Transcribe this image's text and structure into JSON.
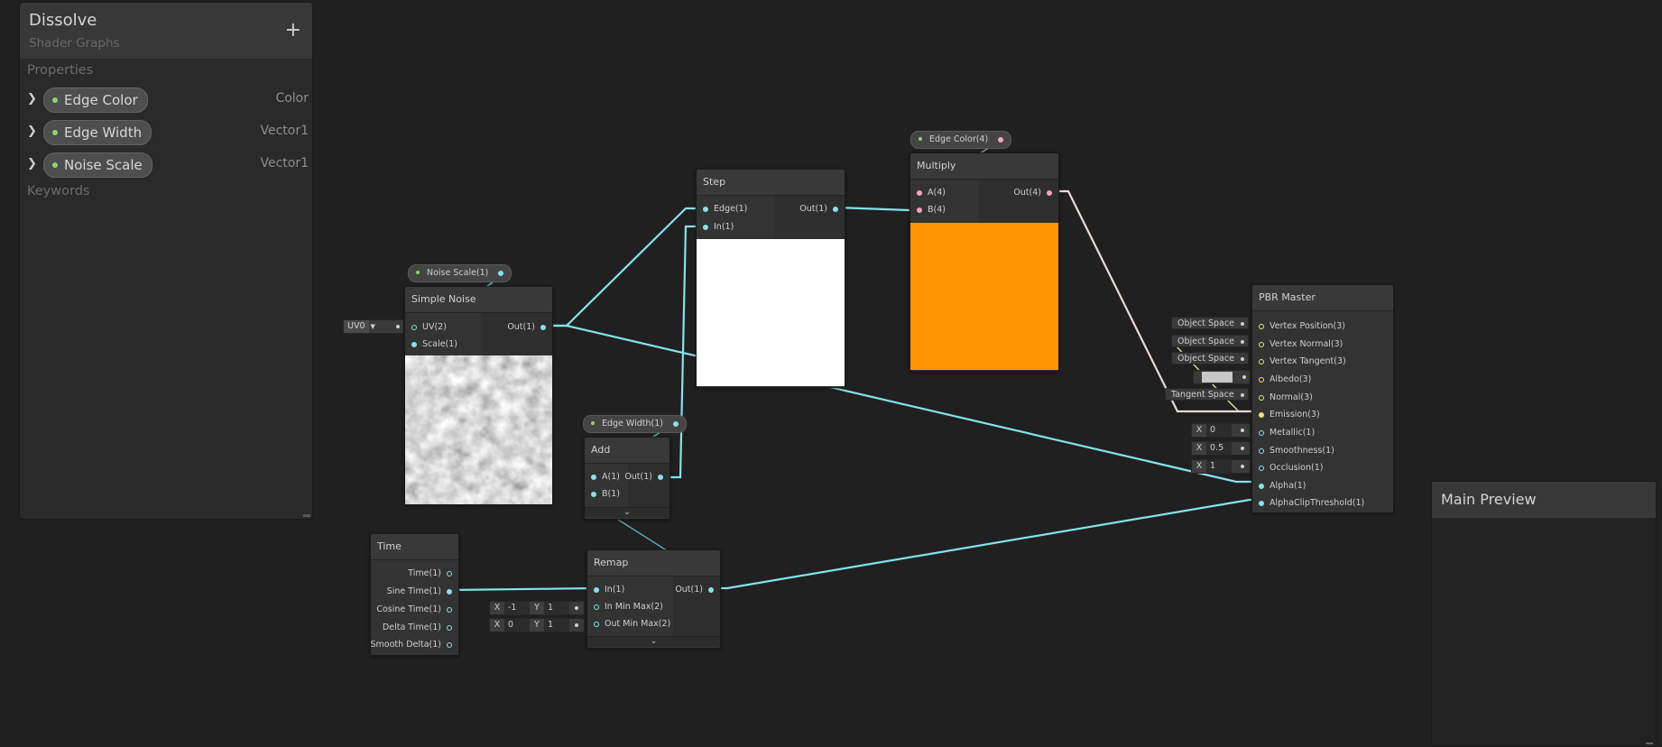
{
  "blackboard": {
    "title": "Dissolve",
    "subtitle": "Shader Graphs",
    "add_label": "+",
    "properties_label": "Properties",
    "keywords_label": "Keywords",
    "properties": [
      {
        "name": "Edge Color",
        "type": "Color"
      },
      {
        "name": "Edge Width",
        "type": "Vector1"
      },
      {
        "name": "Noise Scale",
        "type": "Vector1"
      }
    ]
  },
  "nodes": {
    "noise_scale_prop": "Noise Scale(1)",
    "edge_width_prop": "Edge Width(1)",
    "edge_color_prop": "Edge Color(4)",
    "simple_noise": {
      "title": "Simple Noise",
      "in_uv": "UV(2)",
      "in_scale": "Scale(1)",
      "out": "Out(1)",
      "uv_dropdown": "UV0"
    },
    "step": {
      "title": "Step",
      "in_edge": "Edge(1)",
      "in_in": "In(1)",
      "out": "Out(1)"
    },
    "multiply": {
      "title": "Multiply",
      "in_a": "A(4)",
      "in_b": "B(4)",
      "out": "Out(4)"
    },
    "add": {
      "title": "Add",
      "in_a": "A(1)",
      "in_b": "B(1)",
      "out": "Out(1)"
    },
    "time": {
      "title": "Time",
      "outs": [
        "Time(1)",
        "Sine Time(1)",
        "Cosine Time(1)",
        "Delta Time(1)",
        "Smooth Delta(1)"
      ]
    },
    "remap": {
      "title": "Remap",
      "in_in": "In(1)",
      "in_min": "In Min Max(2)",
      "out_min": "Out Min Max(2)",
      "out": "Out(1)",
      "in_min_x": "-1",
      "in_min_y": "1",
      "out_min_x": "0",
      "out_min_y": "1"
    },
    "pbr": {
      "title": "PBR Master",
      "inputs": [
        "Vertex Position(3)",
        "Vertex Normal(3)",
        "Vertex Tangent(3)",
        "Albedo(3)",
        "Normal(3)",
        "Emission(3)",
        "Metallic(1)",
        "Smoothness(1)",
        "Occlusion(1)",
        "Alpha(1)",
        "AlphaClipThreshold(1)"
      ],
      "space_object": "Object Space",
      "space_tangent": "Tangent Space",
      "metallic": "0",
      "smoothness": "0.5",
      "occlusion": "1"
    }
  },
  "axis_labels": {
    "x": "X",
    "y": "Y"
  },
  "preview": {
    "title": "Main Preview"
  },
  "colors": {
    "edge_color_swatch": "#ff9500",
    "step_preview": "#ffffff",
    "albedo_swatch": "#c8c8c8",
    "wire_float": "#84e4e7",
    "wire_vec4": "#f1a5c4"
  }
}
